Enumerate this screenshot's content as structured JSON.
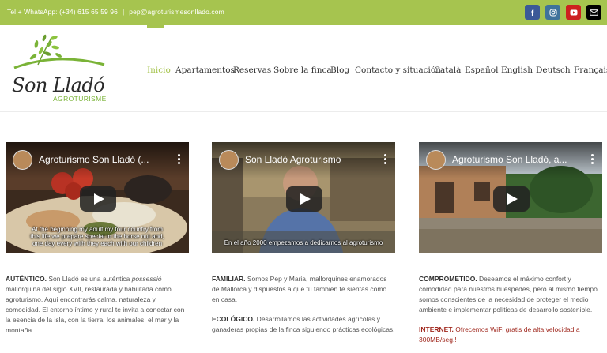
{
  "topbar": {
    "phone": "Tel + WhatsApp: (+34) 615 65 59 96",
    "separator": "|",
    "email": "pep@agroturismesonllado.com",
    "social": [
      {
        "icon": "facebook-icon",
        "color": "#3b5998"
      },
      {
        "icon": "instagram-icon",
        "color": "#3f729b"
      },
      {
        "icon": "youtube-icon",
        "color": "#cd201f"
      },
      {
        "icon": "mail-icon",
        "color": "#000000"
      }
    ]
  },
  "logo": {
    "name": "Son Lladó",
    "subtitle": "AGROTURISME"
  },
  "nav": {
    "items": [
      "Inicio",
      "Apartamentos",
      "Reservas",
      "Sobre la finca",
      "Blog",
      "Contacto y situación",
      "Català",
      "Español",
      "English",
      "Deutsch",
      "Français"
    ],
    "active": "Inicio",
    "active_color": "#a6c44f"
  },
  "videos": [
    {
      "title": "Agroturismo Son Lladó (...",
      "caption": "At the beginning my adult my four country from this life we prepare special in the horse out and, one day every with they each with our children"
    },
    {
      "title": "Son Lladó Agroturismo",
      "caption": "En el año 2000 empezamos a dedicarnos al agroturismo"
    },
    {
      "title": "Agroturismo Son Lladó, a...",
      "caption": ""
    }
  ],
  "columns": {
    "c1": {
      "lead": "AUTÉNTICO.",
      "text1": " Son Lladó es una auténtica ",
      "italic": "possessió",
      "text2": " mallorquina del siglo XVII, restaurada y habilitada como agroturismo. Aquí encontrarás calma, naturaleza y comodidad. El entorno íntimo y rural te invita a conectar con la esencia de la isla, con la tierra, los animales, el mar y la montaña."
    },
    "c2": {
      "lead1": "FAMILIAR.",
      "text1": " Somos Pep y Maria, mallorquines enamorados de Mallorca y dispuestos a que tú también te sientas como en casa.",
      "lead2": "ECOLÓGICO.",
      "text2": " Desarrollamos las actividades agrícolas y ganaderas propias de la finca siguiendo prácticas ecológicas."
    },
    "c3": {
      "lead1": "COMPROMETIDO.",
      "text1": " Deseamos el máximo confort y comodidad para nuestros huéspedes, pero al mismo tiempo somos conscientes de la necesidad de proteger el medio ambiente e implementar políticas de desarrollo sostenible.",
      "lead2": "INTERNET.",
      "text2": " Ofrecemos WiFi gratis de alta velocidad a 300MB/seg.!"
    }
  }
}
